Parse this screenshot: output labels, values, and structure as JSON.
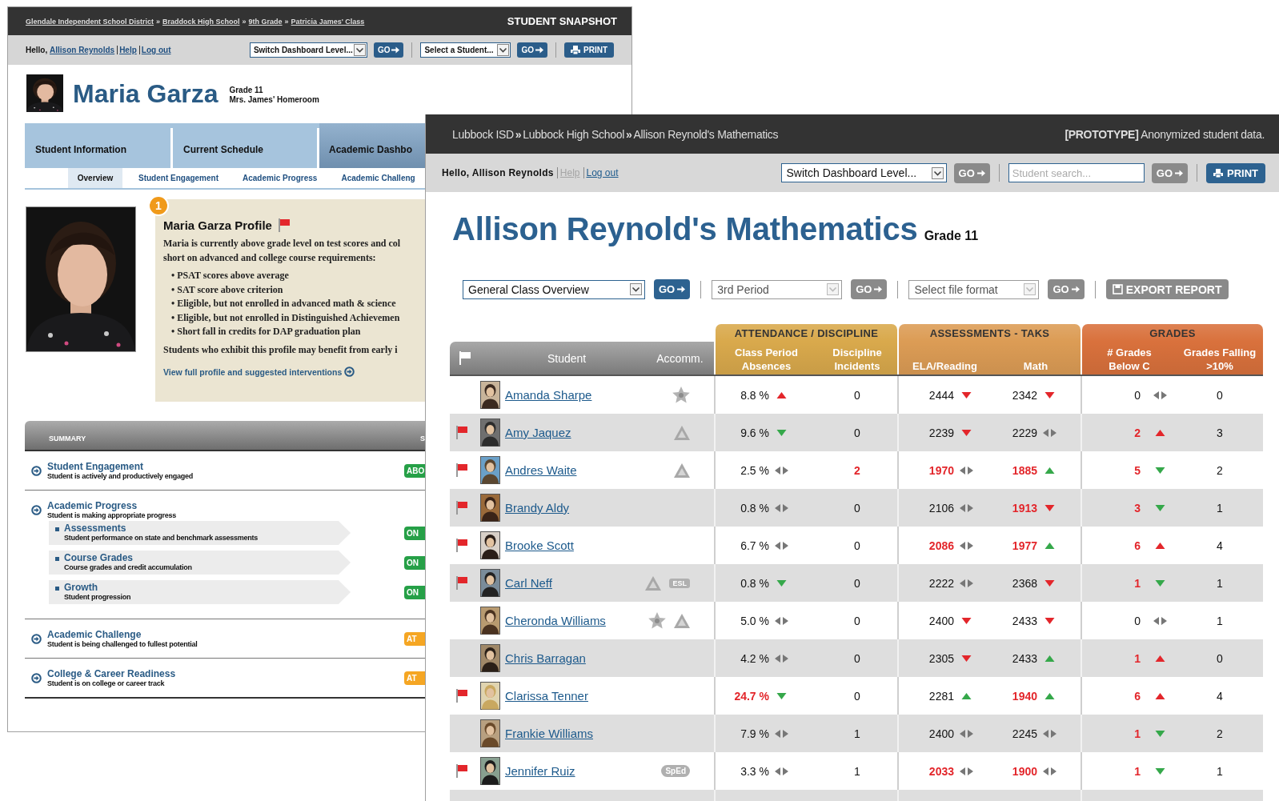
{
  "background_window": {
    "breadcrumb": [
      "Glendale Independent School District",
      "Braddock High School",
      "9th Grade",
      "Patricia James' Class"
    ],
    "breadcrumb_separator": "»",
    "title": "STUDENT SNAPSHOT",
    "greeting": "Hello,",
    "user": "Allison Reynolds",
    "help": "Help",
    "logout": "Log out",
    "controls": [
      {
        "kind": "select",
        "value": "Switch Dashboard Level..."
      },
      {
        "kind": "go",
        "label": "GO"
      },
      {
        "kind": "select",
        "value": "Select a Student..."
      },
      {
        "kind": "go",
        "label": "GO"
      },
      {
        "kind": "print",
        "label": "PRINT"
      }
    ],
    "student": {
      "name": "Maria Garza",
      "grade": "Grade 11",
      "homeroom": "Mrs. James' Homeroom"
    },
    "tabs": [
      {
        "label": "Student Information",
        "selected": false
      },
      {
        "label": "Current Schedule",
        "selected": false
      },
      {
        "label": "Academic Dashbo",
        "selected": true
      }
    ],
    "subtabs": [
      {
        "label": "Overview",
        "selected": true
      },
      {
        "label": "Student Engagement",
        "selected": false
      },
      {
        "label": "Academic Progress",
        "selected": false
      },
      {
        "label": "Academic Challeng",
        "selected": false
      }
    ],
    "profile": {
      "badge": "1",
      "title": "Maria Garza Profile",
      "flagged": true,
      "intro": [
        "Maria is currently above grade level on test scores and col",
        "short on advanced and college course requirements:"
      ],
      "bullets": [
        "• PSAT scores above average",
        "• SAT score above criterion",
        "• Eligible, but not enrolled in advanced math & science",
        "• Eligible, but not enrolled in Distinguished Achievemen",
        "• Short fall in credits for DAP graduation plan"
      ],
      "outro": "Students who exhibit this profile may benefit from early i",
      "link": "View full profile and suggested interventions"
    },
    "summary": {
      "columns": [
        "SUMMARY",
        "S"
      ],
      "rows": [
        {
          "title": "Student Engagement",
          "description": "Student is actively and productively engaged",
          "status": "ABO",
          "color": "#26a047"
        },
        {
          "title": "Academic Progress",
          "description": "Student is making appropriate progress",
          "children": [
            {
              "title": "Assessments",
              "description": "Student performance on state and benchmark assessments",
              "status": "ON",
              "color": "#26a047"
            },
            {
              "title": "Course Grades",
              "description": "Course grades and credit accumulation",
              "status": "ON",
              "color": "#26a047"
            },
            {
              "title": "Growth",
              "description": "Student progression",
              "status": "ON",
              "color": "#26a047"
            }
          ]
        },
        {
          "title": "Academic Challenge",
          "description": "Student is being challenged to fullest potential",
          "status": "AT",
          "color": "#f5a623"
        },
        {
          "title": "College & Career Readiness",
          "description": "Student is on college or career track",
          "status": "AT",
          "color": "#f5a623"
        }
      ]
    }
  },
  "front_window": {
    "breadcrumb": [
      "Lubbock ISD",
      "Lubbock High School",
      "Allison Reynold's Mathematics"
    ],
    "breadcrumb_separator": "»",
    "notice": "**[PROTOTYPE]** Anonymized student data.",
    "greeting": "Hello, Allison Reynolds",
    "help": {
      "label": "Help",
      "disabled": true
    },
    "logout": "Log out",
    "controls": [
      {
        "kind": "select",
        "value": "Switch Dashboard Level...",
        "disabled": false
      },
      {
        "kind": "go",
        "label": "GO",
        "disabled": true
      },
      {
        "kind": "search",
        "placeholder": "Student search..."
      },
      {
        "kind": "go",
        "label": "GO",
        "disabled": true
      },
      {
        "kind": "print",
        "label": "PRINT",
        "disabled": false
      }
    ],
    "title": "Allison Reynold's Mathematics",
    "grade": "Grade 11",
    "toolbar": [
      {
        "kind": "select",
        "value": "General Class Overview",
        "disabled": false
      },
      {
        "kind": "go",
        "label": "GO",
        "disabled": false
      },
      {
        "kind": "select",
        "value": "3rd Period",
        "disabled": true
      },
      {
        "kind": "go",
        "label": "GO",
        "disabled": true
      },
      {
        "kind": "select",
        "value": "Select file format",
        "disabled": true
      },
      {
        "kind": "go",
        "label": "GO",
        "disabled": true
      },
      {
        "kind": "export",
        "label": "EXPORT REPORT",
        "disabled": true
      }
    ]
  },
  "class_table": {
    "left_columns": [
      "Student",
      "Accomm."
    ],
    "groups": [
      {
        "title": "ATTENDANCE / DISCIPLINE",
        "color": "#d9a94c",
        "columns": [
          "Class Period Absences",
          "Discipline Incidents"
        ]
      },
      {
        "title": "ASSESSMENTS - TAKS",
        "color": "#dc9c55",
        "columns": [
          "ELA/Reading",
          "Math"
        ]
      },
      {
        "title": "GRADES",
        "color": "#d9713c",
        "columns": [
          "# Grades Below C",
          "Grades Falling >10%"
        ]
      }
    ],
    "rows": [
      {
        "name": "Amanda Sharpe",
        "flagged": false,
        "accommodations": [
          {
            "kind": "star"
          }
        ],
        "cells": [
          {
            "value": "8.8 %",
            "alert": false,
            "trend": {
              "kind": "up",
              "color": "#e3262b"
            }
          },
          {
            "value": "0",
            "alert": false
          },
          {
            "value": "2444",
            "alert": false,
            "trend": {
              "kind": "down",
              "color": "#e3262b"
            }
          },
          {
            "value": "2342",
            "alert": false,
            "trend": {
              "kind": "down",
              "color": "#e3262b"
            }
          },
          {
            "value": "0",
            "alert": false,
            "trend": {
              "kind": "flat"
            }
          },
          {
            "value": "0",
            "alert": false
          }
        ]
      },
      {
        "name": "Amy Jaquez",
        "flagged": true,
        "accommodations": [
          {
            "kind": "triangle"
          }
        ],
        "cells": [
          {
            "value": "9.6 %",
            "alert": false,
            "trend": {
              "kind": "down",
              "color": "#35a84a"
            }
          },
          {
            "value": "0",
            "alert": false
          },
          {
            "value": "2239",
            "alert": false,
            "trend": {
              "kind": "down",
              "color": "#e3262b"
            }
          },
          {
            "value": "2229",
            "alert": false,
            "trend": {
              "kind": "flat"
            }
          },
          {
            "value": "2",
            "alert": true,
            "trend": {
              "kind": "up",
              "color": "#e3262b"
            }
          },
          {
            "value": "3",
            "alert": false
          }
        ]
      },
      {
        "name": "Andres Waite",
        "flagged": true,
        "accommodations": [
          {
            "kind": "triangle"
          }
        ],
        "cells": [
          {
            "value": "2.5 %",
            "alert": false,
            "trend": {
              "kind": "flat"
            }
          },
          {
            "value": "2",
            "alert": true
          },
          {
            "value": "1970",
            "alert": true,
            "trend": {
              "kind": "flat"
            }
          },
          {
            "value": "1885",
            "alert": true,
            "trend": {
              "kind": "up",
              "color": "#35a84a"
            }
          },
          {
            "value": "5",
            "alert": true,
            "trend": {
              "kind": "down",
              "color": "#35a84a"
            }
          },
          {
            "value": "2",
            "alert": false
          }
        ]
      },
      {
        "name": "Brandy Aldy",
        "flagged": true,
        "accommodations": [],
        "cells": [
          {
            "value": "0.8 %",
            "alert": false,
            "trend": {
              "kind": "flat"
            }
          },
          {
            "value": "0",
            "alert": false
          },
          {
            "value": "2106",
            "alert": false,
            "trend": {
              "kind": "flat"
            }
          },
          {
            "value": "1913",
            "alert": true,
            "trend": {
              "kind": "down",
              "color": "#e3262b"
            }
          },
          {
            "value": "3",
            "alert": true,
            "trend": {
              "kind": "down",
              "color": "#35a84a"
            }
          },
          {
            "value": "1",
            "alert": false
          }
        ]
      },
      {
        "name": "Brooke Scott",
        "flagged": true,
        "accommodations": [],
        "cells": [
          {
            "value": "6.7 %",
            "alert": false,
            "trend": {
              "kind": "flat"
            }
          },
          {
            "value": "0",
            "alert": false
          },
          {
            "value": "2086",
            "alert": true,
            "trend": {
              "kind": "flat"
            }
          },
          {
            "value": "1977",
            "alert": true,
            "trend": {
              "kind": "up",
              "color": "#35a84a"
            }
          },
          {
            "value": "6",
            "alert": true,
            "trend": {
              "kind": "up",
              "color": "#e3262b"
            }
          },
          {
            "value": "4",
            "alert": false
          }
        ]
      },
      {
        "name": "Carl Neff",
        "flagged": true,
        "accommodations": [
          {
            "kind": "triangle"
          },
          {
            "kind": "tag",
            "label": "ESL"
          }
        ],
        "cells": [
          {
            "value": "0.8 %",
            "alert": false,
            "trend": {
              "kind": "down",
              "color": "#35a84a"
            }
          },
          {
            "value": "0",
            "alert": false
          },
          {
            "value": "2222",
            "alert": false,
            "trend": {
              "kind": "flat"
            }
          },
          {
            "value": "2368",
            "alert": false,
            "trend": {
              "kind": "down",
              "color": "#e3262b"
            }
          },
          {
            "value": "1",
            "alert": true,
            "trend": {
              "kind": "down",
              "color": "#35a84a"
            }
          },
          {
            "value": "1",
            "alert": false
          }
        ]
      },
      {
        "name": "Cheronda Williams",
        "flagged": false,
        "accommodations": [
          {
            "kind": "star"
          },
          {
            "kind": "triangle"
          }
        ],
        "cells": [
          {
            "value": "5.0 %",
            "alert": false,
            "trend": {
              "kind": "flat"
            }
          },
          {
            "value": "0",
            "alert": false
          },
          {
            "value": "2400",
            "alert": false,
            "trend": {
              "kind": "down",
              "color": "#e3262b"
            }
          },
          {
            "value": "2433",
            "alert": false,
            "trend": {
              "kind": "down",
              "color": "#e3262b"
            }
          },
          {
            "value": "0",
            "alert": false,
            "trend": {
              "kind": "flat"
            }
          },
          {
            "value": "1",
            "alert": false
          }
        ]
      },
      {
        "name": "Chris Barragan",
        "flagged": false,
        "accommodations": [],
        "cells": [
          {
            "value": "4.2 %",
            "alert": false,
            "trend": {
              "kind": "flat"
            }
          },
          {
            "value": "0",
            "alert": false
          },
          {
            "value": "2305",
            "alert": false,
            "trend": {
              "kind": "down",
              "color": "#e3262b"
            }
          },
          {
            "value": "2433",
            "alert": false,
            "trend": {
              "kind": "up",
              "color": "#35a84a"
            }
          },
          {
            "value": "1",
            "alert": true,
            "trend": {
              "kind": "up",
              "color": "#e3262b"
            }
          },
          {
            "value": "0",
            "alert": false
          }
        ]
      },
      {
        "name": "Clarissa Tenner",
        "flagged": true,
        "accommodations": [],
        "cells": [
          {
            "value": "24.7 %",
            "alert": true,
            "trend": {
              "kind": "down",
              "color": "#35a84a"
            }
          },
          {
            "value": "0",
            "alert": false
          },
          {
            "value": "2281",
            "alert": false,
            "trend": {
              "kind": "up",
              "color": "#35a84a"
            }
          },
          {
            "value": "1940",
            "alert": true,
            "trend": {
              "kind": "up",
              "color": "#35a84a"
            }
          },
          {
            "value": "6",
            "alert": true,
            "trend": {
              "kind": "up",
              "color": "#e3262b"
            }
          },
          {
            "value": "4",
            "alert": false
          }
        ]
      },
      {
        "name": "Frankie Williams",
        "flagged": false,
        "accommodations": [],
        "cells": [
          {
            "value": "7.9 %",
            "alert": false,
            "trend": {
              "kind": "flat"
            }
          },
          {
            "value": "1",
            "alert": false
          },
          {
            "value": "2400",
            "alert": false,
            "trend": {
              "kind": "flat"
            }
          },
          {
            "value": "2245",
            "alert": false,
            "trend": {
              "kind": "flat"
            }
          },
          {
            "value": "1",
            "alert": true,
            "trend": {
              "kind": "down",
              "color": "#35a84a"
            }
          },
          {
            "value": "2",
            "alert": false
          }
        ]
      },
      {
        "name": "Jennifer Ruiz",
        "flagged": true,
        "accommodations": [
          {
            "kind": "tag",
            "label": "SpEd"
          }
        ],
        "cells": [
          {
            "value": "3.3 %",
            "alert": false,
            "trend": {
              "kind": "flat"
            }
          },
          {
            "value": "1",
            "alert": false
          },
          {
            "value": "2033",
            "alert": true,
            "trend": {
              "kind": "flat"
            }
          },
          {
            "value": "1900",
            "alert": true,
            "trend": {
              "kind": "flat"
            }
          },
          {
            "value": "1",
            "alert": true,
            "trend": {
              "kind": "down",
              "color": "#35a84a"
            }
          },
          {
            "value": "1",
            "alert": false
          }
        ]
      }
    ]
  }
}
